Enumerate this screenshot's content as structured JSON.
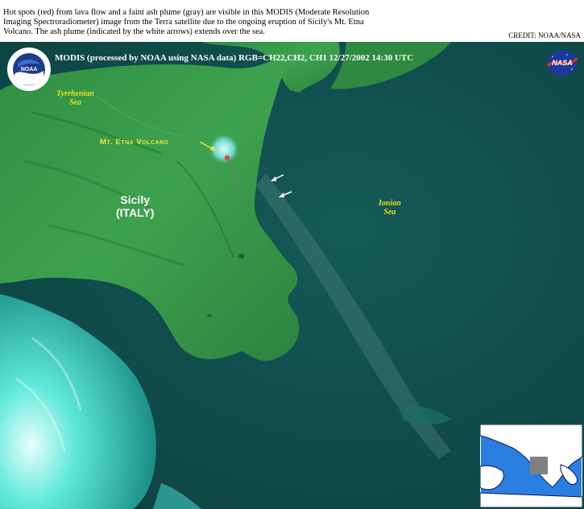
{
  "caption": {
    "line1": "Hot spots (red) from lava flow and a faint ash plume (gray) are visible in this MODIS (Moderate Resolution",
    "line2": "Imaging Spectroradiometer) image from the Terra satellite due to the ongoing eruption of Sicily's Mt. Etna",
    "line3": "Volcano.  The ash plume (indicated by the white arrows) extends over the sea."
  },
  "credit": "CREDIT: NOAA/NASA",
  "image_header": "MODIS  (processed by NOAA using NASA data)  RGB=CH22,CH2, CH1  12/27/2002  14:30 UTC",
  "labels": {
    "tyrrhenian_line1": "Tyrrhenian",
    "tyrrhenian_line2": "Sea",
    "ionian_line1": "Ionian",
    "ionian_line2": "Sea",
    "etna": "Mt. Etna Volcano",
    "island_line1": "Sicily",
    "island_line2": "(ITALY)"
  },
  "logos": {
    "noaa": "NOAA",
    "nasa": "NASA"
  },
  "colors": {
    "land": "#3a9a4a",
    "sea": "#0f4a4a",
    "clouds": "#40e0d0",
    "label_yellow": "#e8e020",
    "hot_spot": "#ff3030"
  }
}
